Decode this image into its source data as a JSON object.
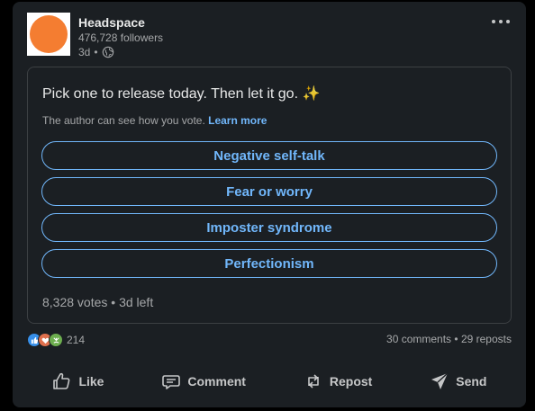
{
  "post": {
    "author_name": "Headspace",
    "followers": "476,728 followers",
    "age": "3d",
    "separator": "•",
    "brand_color": "#f47d31"
  },
  "poll": {
    "question": "Pick one to release today. Then let it go. ✨",
    "note": "The author can see how you vote.",
    "learn_more": "Learn more",
    "options": [
      "Negative self-talk",
      "Fear or worry",
      "Imposter syndrome",
      "Perfectionism"
    ],
    "stats": "8,328 votes • 3d left"
  },
  "social": {
    "reaction_count": "214",
    "comments": "30 comments",
    "separator": "•",
    "reposts": "29 reposts",
    "reaction_icons": [
      "like-icon",
      "love-icon",
      "celebrate-icon"
    ]
  },
  "actions": {
    "like": "Like",
    "comment": "Comment",
    "repost": "Repost",
    "send": "Send"
  },
  "colors": {
    "accent": "#71b7fb",
    "card_bg": "#1b1f23"
  }
}
